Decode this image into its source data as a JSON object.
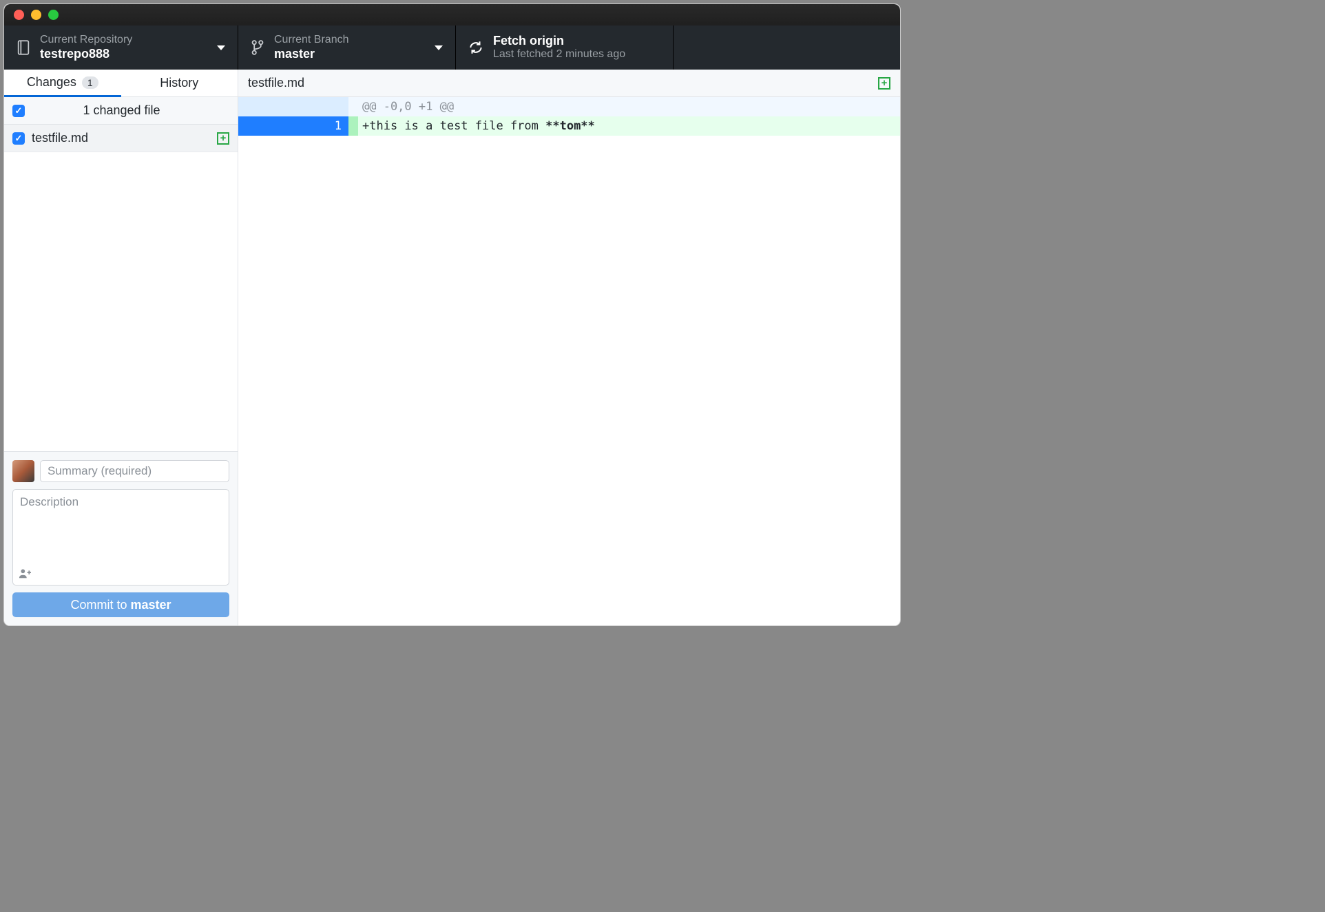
{
  "toolbar": {
    "repo": {
      "label": "Current Repository",
      "value": "testrepo888"
    },
    "branch": {
      "label": "Current Branch",
      "value": "master"
    },
    "fetch": {
      "label": "Fetch origin",
      "value": "Last fetched 2 minutes ago"
    }
  },
  "sidebar": {
    "tabs": {
      "changes": {
        "label": "Changes",
        "badge": "1"
      },
      "history": {
        "label": "History"
      }
    },
    "changes_header": "1 changed file",
    "files": [
      {
        "name": "testfile.md",
        "checked": true,
        "status": "added"
      }
    ],
    "commit": {
      "summary_placeholder": "Summary (required)",
      "description_placeholder": "Description",
      "button_prefix": "Commit to ",
      "button_branch": "master"
    }
  },
  "diff": {
    "filename": "testfile.md",
    "file_status": "added",
    "rows": [
      {
        "type": "hunk",
        "old_no": "",
        "new_no": "",
        "prefix": "",
        "text": "@@ -0,0 +1 @@"
      },
      {
        "type": "add",
        "old_no": "",
        "new_no": "1",
        "prefix": "+",
        "text": "this is a test file from ",
        "bold": "**tom**"
      }
    ]
  }
}
